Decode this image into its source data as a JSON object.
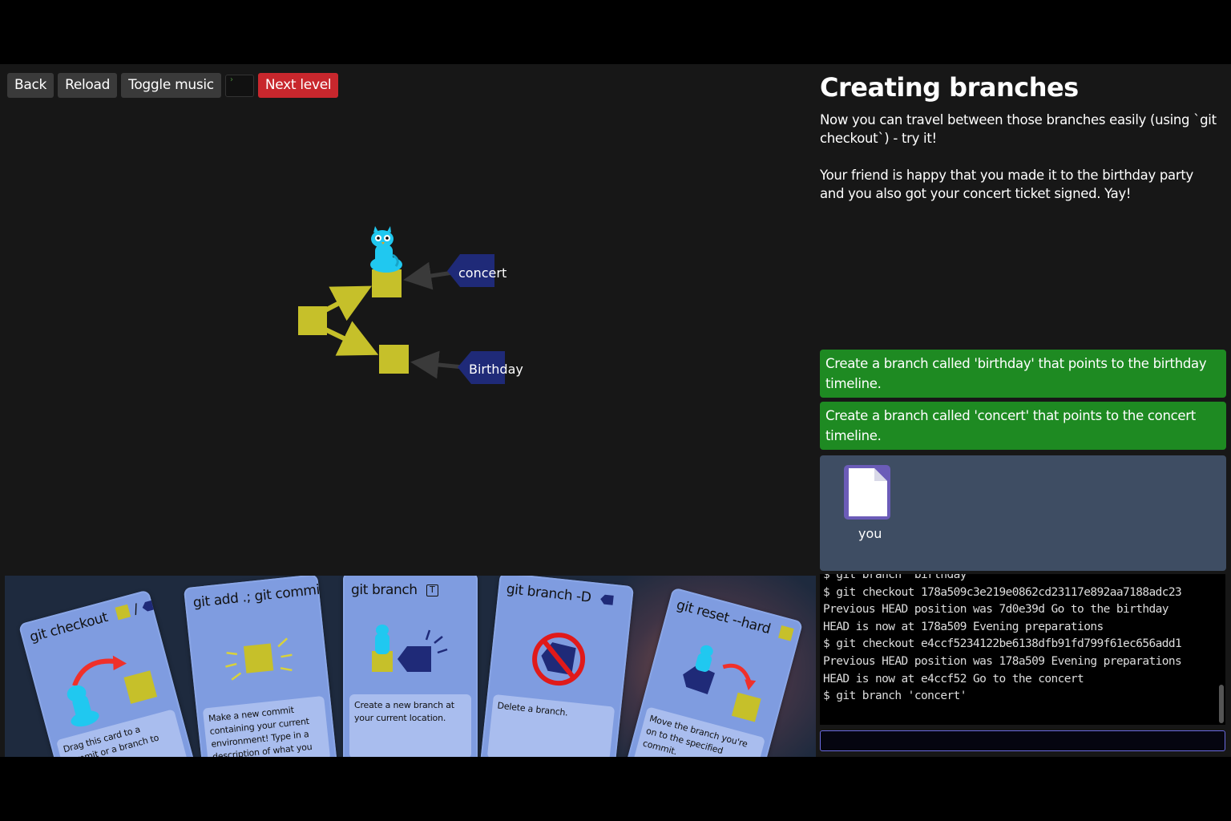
{
  "toolbar": {
    "back": "Back",
    "reload": "Reload",
    "toggle_music": "Toggle music",
    "terminal_glyph": "›",
    "next_level": "Next level"
  },
  "level": {
    "title": "Creating branches",
    "description": [
      "Now you can travel between those branches easily (using `git checkout`) - try it!",
      "Your friend is happy that you made it to the birthday party and you also got your concert ticket signed. Yay!"
    ]
  },
  "goals": [
    "Create a branch called 'birthday' that points to the birthday timeline.",
    "Create a branch called 'concert' that points to the concert timeline."
  ],
  "inventory": {
    "item_label": "you"
  },
  "graph": {
    "branches": [
      "concert",
      "Birthday"
    ],
    "colors": {
      "commit": "#c6c02a",
      "branch": "#1f2a78",
      "arrow": "#3a3a3a",
      "head": "#20c8f0"
    }
  },
  "terminal": {
    "lines": [
      "$ git branch 'birthday'",
      "$ git checkout 178a509c3e219e0862cd23117e892aa7188adc23",
      "Previous HEAD position was 7d0e39d Go to the birthday",
      "HEAD is now at 178a509 Evening preparations",
      "$ git checkout e4ccf5234122be6138dfb91fd799f61ec656add1",
      "Previous HEAD position was 178a509 Evening preparations",
      "HEAD is now at e4ccf52 Go to the concert",
      "$ git branch 'concert'"
    ],
    "input_value": ""
  },
  "cards": [
    {
      "title": "git checkout",
      "title_suffix": "/",
      "desc": "Drag this card to a commit or a branch to travel to it."
    },
    {
      "title": "git add .; git commit",
      "desc": "Make a new commit containing your current environment! Type in a description of what you did."
    },
    {
      "title": "git branch",
      "key_hint": "T",
      "desc": "Create a new branch at your current location."
    },
    {
      "title": "git branch -D",
      "desc": "Delete a branch."
    },
    {
      "title": "git reset --hard",
      "desc": "Move the branch you're on to the specified commit."
    }
  ]
}
